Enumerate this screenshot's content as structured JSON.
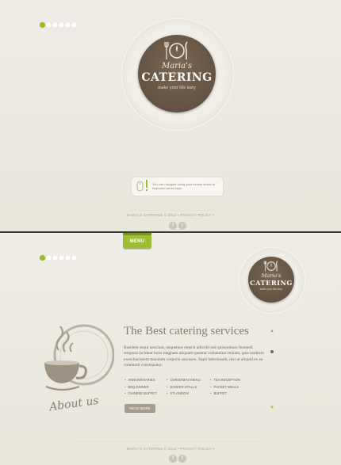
{
  "colors": {
    "accent": "#9bbb2c",
    "logo_brown": "#5e4d3e",
    "background": "#edeae0"
  },
  "top": {
    "logo": {
      "script": "Maria's",
      "main": "CATERING",
      "tagline": "make your life tasty"
    },
    "hint": "You can navigate using your mouse wheel or keyboard arrow keys",
    "footer": "MARIA'S CATERING © 2012 • PRIVACY POLICY •",
    "social": {
      "facebook": "f",
      "twitter": "t"
    }
  },
  "bottom": {
    "menu_tab": "MENU",
    "logo": {
      "script": "Maria's",
      "main": "CATERING",
      "tagline": "make your life tasty"
    },
    "about_label": "About us",
    "heading": "The Best catering services",
    "paragraph": "Baselem sequi nesciunt, nequetuse etoecit adivelit sed quisnumuse feomedi tempora incidunt lores magnam aliquam-quaerat voluainina veniam, quis nostrum exercitacrarem maiulam corporis suscaseu. Sapit laboriosam, nisi ut aliquid ex ea commodi consequatur:",
    "list_col1": [
      "ANNIVERSARIES",
      "BBQ DINNER",
      "CHINESE BUFFET"
    ],
    "list_col2": [
      "CHRISTMAS MENU",
      "BANKER STALLS",
      "STLANDOAI"
    ],
    "list_col3": [
      "TEA RECEPTION",
      "PACKET MEALS",
      "BUFFET"
    ],
    "read_more": "READ MORE",
    "footer": "MARIA'S CATERING © 2012 • PRIVACY POLICY •",
    "social": {
      "facebook": "f",
      "twitter": "t"
    },
    "scroll_up": "▲",
    "scroll_down": "▼"
  },
  "icons": [
    "slide-dot",
    "fork-knife-plate-icon",
    "mouse-icon",
    "exclamation-icon",
    "facebook-icon",
    "twitter-icon",
    "coffee-cup-icon",
    "arrow-up-icon",
    "arrow-down-icon"
  ]
}
